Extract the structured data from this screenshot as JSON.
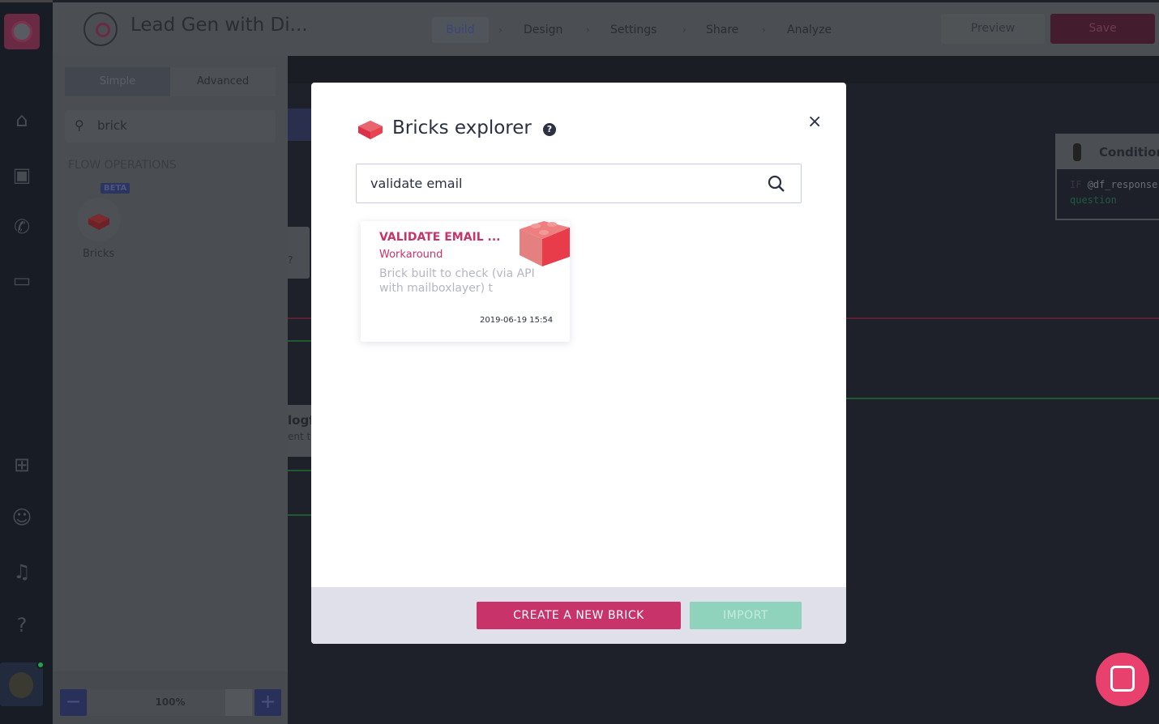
{
  "app": {
    "title": "Lead Gen with Di..."
  },
  "nav": {
    "steps": [
      "Build",
      "Design",
      "Settings",
      "Share",
      "Analyze"
    ],
    "active": "Build",
    "separator": "›"
  },
  "header": {
    "preview_label": "Preview",
    "save_label": "Save"
  },
  "sidebar": {
    "icons": [
      "home-icon",
      "robot-icon",
      "whatsapp-icon",
      "chat-icon",
      "gift-icon",
      "feedback-icon",
      "bell-icon",
      "help-icon"
    ]
  },
  "panel": {
    "tabs": [
      "Simple",
      "Advanced"
    ],
    "search_value": "brick",
    "section": "FLOW OPERATIONS",
    "item": {
      "badge": "BETA",
      "label": "Bricks"
    },
    "zoom": {
      "value": "100%",
      "minus": "−",
      "plus": "+"
    }
  },
  "canvas": {
    "condition": {
      "title": "Condition",
      "keyword": "IF",
      "expr": "@df_response",
      "line2": "question"
    },
    "node_partial": {
      "q": "?",
      "title": "logf",
      "sub": "ent te"
    }
  },
  "modal": {
    "title": "Bricks explorer",
    "help": "?",
    "close": "×",
    "search_value": "validate email",
    "results": [
      {
        "title": "VALIDATE EMAIL ...",
        "category": "Workaround",
        "description": "Brick built to check (via API with mailboxlayer) t",
        "date": "2019-06-19 15:54"
      }
    ],
    "create_label": "CREATE A NEW BRICK",
    "import_label": "IMPORT"
  },
  "colors": {
    "accent": "#c8336a",
    "import": "#8fd3bd",
    "chat": "#e8416d",
    "brick": "#e8434f"
  }
}
